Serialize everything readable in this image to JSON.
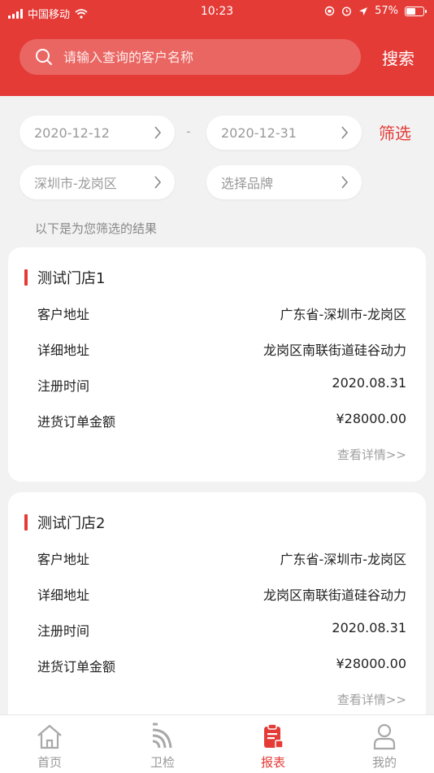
{
  "status_bar": {
    "carrier": "中国移动",
    "time": "10:23",
    "battery": "57%",
    "battery_level": 0.57
  },
  "search": {
    "placeholder": "请输入查询的客户名称",
    "button_label": "搜索"
  },
  "filters": {
    "start_date": "2020-12-12",
    "separator": "-",
    "end_date": "2020-12-31",
    "filter_label": "筛选",
    "region": "深圳市-龙岗区",
    "brand_placeholder": "选择品牌",
    "result_hint": "以下是为您筛选的结果"
  },
  "stores": [
    {
      "name": "测试门店1",
      "rows": [
        {
          "label": "客户地址",
          "value": "广东省-深圳市-龙岗区"
        },
        {
          "label": "详细地址",
          "value": "龙岗区南联街道硅谷动力"
        },
        {
          "label": "注册时间",
          "value": "2020.08.31"
        },
        {
          "label": "进货订单金额",
          "value": "¥28000.00"
        }
      ],
      "detail_link": "查看详情>>"
    },
    {
      "name": "测试门店2",
      "rows": [
        {
          "label": "客户地址",
          "value": "广东省-深圳市-龙岗区"
        },
        {
          "label": "详细地址",
          "value": "龙岗区南联街道硅谷动力"
        },
        {
          "label": "注册时间",
          "value": "2020.08.31"
        },
        {
          "label": "进货订单金额",
          "value": "¥28000.00"
        }
      ],
      "detail_link": "查看详情>>"
    }
  ],
  "tabs": [
    {
      "label": "首页",
      "icon": "home-icon"
    },
    {
      "label": "卫检",
      "icon": "signal-waves-icon"
    },
    {
      "label": "报表",
      "icon": "clipboard-icon",
      "active": true
    },
    {
      "label": "我的",
      "icon": "user-icon"
    }
  ],
  "colors": {
    "accent": "#e43b37",
    "background": "#f2f2f2",
    "muted_text": "#999999"
  }
}
